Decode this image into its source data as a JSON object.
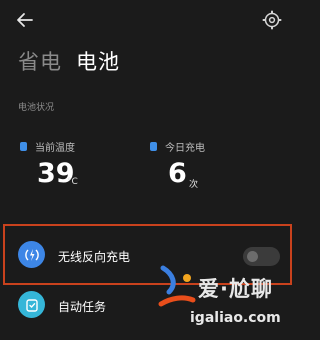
{
  "header": {
    "tabs": [
      {
        "label": "省电",
        "active": false
      },
      {
        "label": "电池",
        "active": true
      }
    ]
  },
  "battery_status": {
    "section_label": "电池状况",
    "current_temp": {
      "label": "当前温度",
      "value": "39",
      "unit": "°C"
    },
    "charges_today": {
      "label": "今日充电",
      "value": "6",
      "unit": "次"
    }
  },
  "settings": [
    {
      "label": "无线反向充电",
      "icon": "wireless-charging-icon",
      "toggle_on": false
    },
    {
      "label": "自动任务",
      "icon": "auto-task-icon"
    }
  ],
  "watermark": {
    "title": "爱·尬聊",
    "url": "igaliao.com"
  },
  "colors": {
    "background": "#1b1b1b",
    "accent_blue": "#3d86e6",
    "highlight_border": "#c9421d",
    "auto_task_cyan": "#35b6d8"
  }
}
